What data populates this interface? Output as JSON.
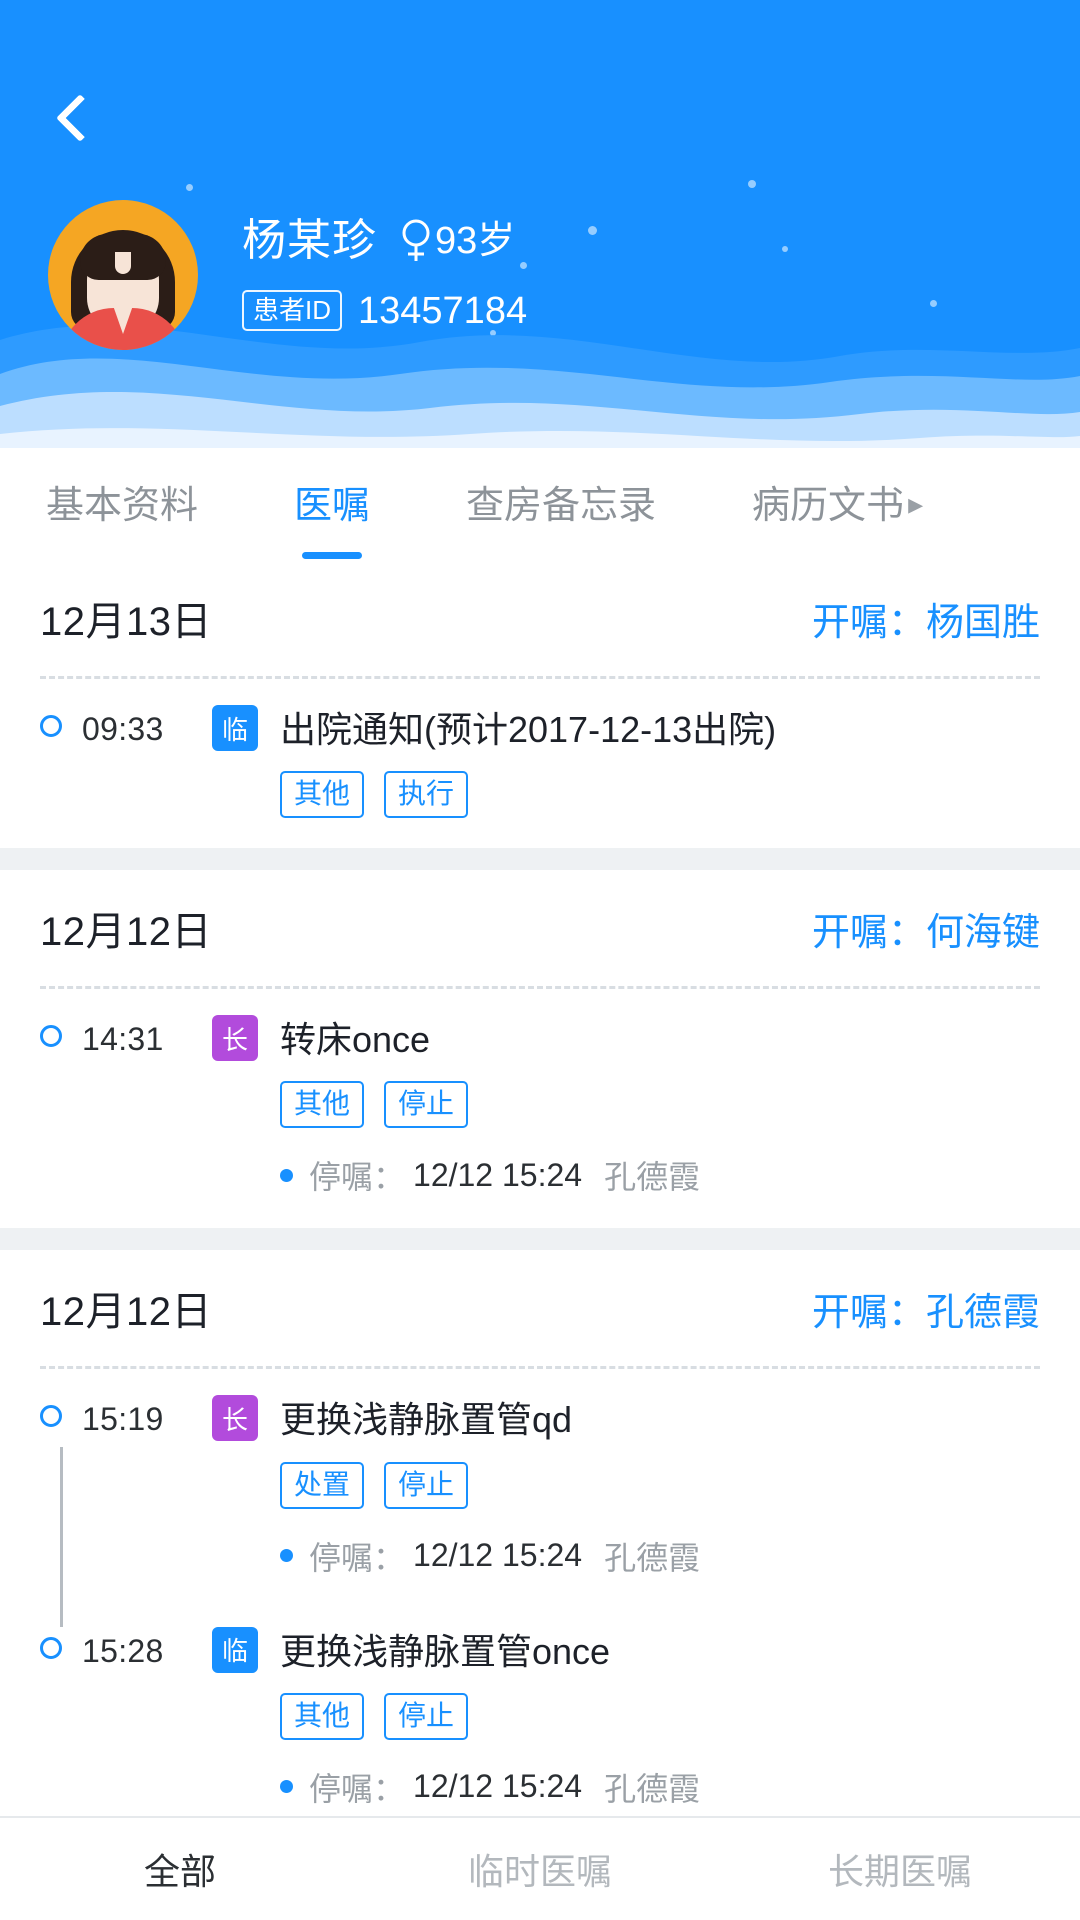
{
  "header": {
    "back_icon": "chevron-left-icon",
    "avatar_icon": "patient-avatar-female",
    "patient_name": "杨某珍",
    "gender_icon": "female-gender-icon",
    "age": "93岁",
    "id_label": "患者ID",
    "id_value": "13457184",
    "bg_color": "#1890ff"
  },
  "tabs": {
    "items": [
      {
        "label": "基本资料",
        "active": false
      },
      {
        "label": "医嘱",
        "active": true
      },
      {
        "label": "查房备忘录",
        "active": false
      },
      {
        "label": "病历文书",
        "active": false
      }
    ],
    "more_arrow": "▸",
    "active_color": "#1890ff",
    "inactive_color": "#8d9399"
  },
  "cards": [
    {
      "date": "12月13日",
      "doctor": "开嘱：杨国胜",
      "orders": [
        {
          "time": "09:33",
          "badge": "临",
          "badge_type": "linshi",
          "badge_color": "#1890ff",
          "title": "出院通知(预计2017-12-13出院)",
          "tags": [
            "其他",
            "执行"
          ],
          "note": null
        }
      ]
    },
    {
      "date": "12月12日",
      "doctor": "开嘱：何海键",
      "orders": [
        {
          "time": "14:31",
          "badge": "长",
          "badge_type": "changqi",
          "badge_color": "#b24bdc",
          "title": "转床once",
          "tags": [
            "其他",
            "停止"
          ],
          "note": {
            "label": "停嘱：",
            "value": "12/12 15:24",
            "by": "孔德霞"
          }
        }
      ]
    },
    {
      "date": "12月12日",
      "doctor": "开嘱：孔德霞",
      "orders": [
        {
          "time": "15:19",
          "badge": "长",
          "badge_type": "changqi",
          "badge_color": "#b24bdc",
          "title": "更换浅静脉置管qd",
          "tags": [
            "处置",
            "停止"
          ],
          "note": {
            "label": "停嘱：",
            "value": "12/12 15:24",
            "by": "孔德霞"
          }
        },
        {
          "time": "15:28",
          "badge": "临",
          "badge_type": "linshi",
          "badge_color": "#1890ff",
          "title": "更换浅静脉置管once",
          "tags": [
            "其他",
            "停止"
          ],
          "note": {
            "label": "停嘱：",
            "value": "12/12 15:24",
            "by": "孔德霞"
          }
        }
      ]
    }
  ],
  "bottom_nav": {
    "items": [
      {
        "label": "全部",
        "active": true
      },
      {
        "label": "临时医嘱",
        "active": false
      },
      {
        "label": "长期医嘱",
        "active": false
      }
    ]
  }
}
